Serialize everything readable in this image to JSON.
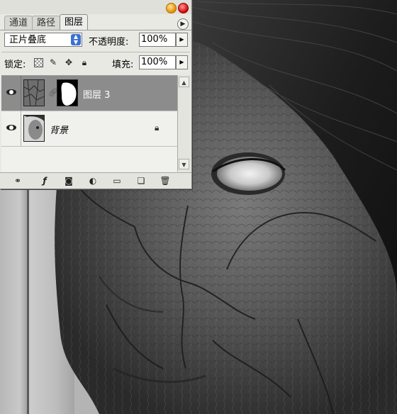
{
  "panel": {
    "tabs": [
      {
        "label": "通道"
      },
      {
        "label": "路径"
      },
      {
        "label": "图层"
      }
    ],
    "blend_mode": "正片叠底",
    "opacity_label": "不透明度:",
    "opacity_value": "100%",
    "lock_label": "锁定:",
    "fill_label": "填充:",
    "fill_value": "100%",
    "layers": [
      {
        "name": "图层 3",
        "selected": true,
        "visible": true,
        "has_mask": true
      },
      {
        "name": "背景",
        "selected": false,
        "visible": true,
        "locked": true
      }
    ],
    "toolbar_icons": [
      "link-icon",
      "fx-icon",
      "mask-icon",
      "adjustment-icon",
      "folder-icon",
      "new-layer-icon",
      "trash-icon"
    ],
    "lock_icons": [
      "lock-transparent-icon",
      "lock-paint-icon",
      "lock-move-icon",
      "lock-all-icon"
    ]
  },
  "colors": {
    "selected_row": "#8c8c8c",
    "panel_bg": "#e9e9e4",
    "close_button": "#d30000",
    "minimize_button": "#e88a00"
  }
}
